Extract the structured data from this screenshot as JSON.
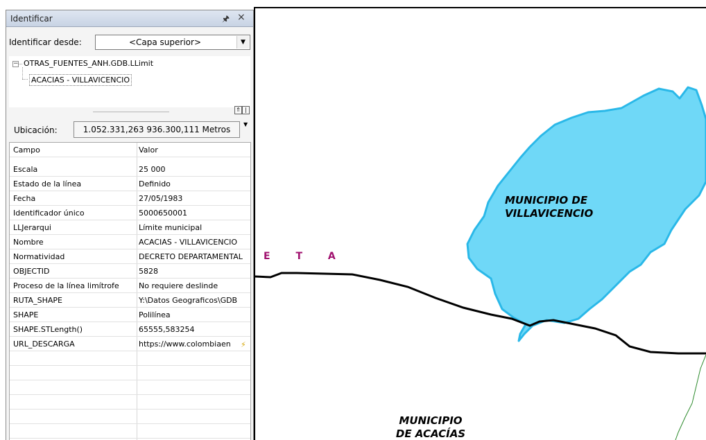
{
  "panel": {
    "title": "Identificar",
    "pin_icon": "pin-icon",
    "close_icon": "close-icon",
    "identify_from_label": "Identificar desde:",
    "identify_from_value": "<Capa superior>",
    "tree": {
      "parent": "OTRAS_FUENTES_ANH.GDB.LLimit",
      "child": "ACACIAS - VILLAVICENCIO"
    },
    "location_label": "Ubicación:",
    "location_value": "1.052.331,263  936.300,111 Metros",
    "columns": {
      "field": "Campo",
      "value": "Valor"
    },
    "rows": [
      {
        "field": "Escala",
        "value": "25 000"
      },
      {
        "field": "Estado de la línea",
        "value": "Definido"
      },
      {
        "field": "Fecha",
        "value": "27/05/1983"
      },
      {
        "field": "Identificador único",
        "value": "5000650001"
      },
      {
        "field": "LLJerarqui",
        "value": "Límite municipal"
      },
      {
        "field": "Nombre",
        "value": "ACACIAS - VILLAVICENCIO"
      },
      {
        "field": "Normatividad",
        "value": "DECRETO DEPARTAMENTAL"
      },
      {
        "field": "OBJECTID",
        "value": "5828"
      },
      {
        "field": "Proceso de la línea limítrofe",
        "value": "No requiere deslinde"
      },
      {
        "field": "RUTA_SHAPE",
        "value": "Y:\\Datos Geograficos\\GDB"
      },
      {
        "field": "SHAPE",
        "value": "Polilínea"
      },
      {
        "field": "SHAPE.STLength()",
        "value": "65555,583254"
      },
      {
        "field": "URL_DESCARGA",
        "value": "https://www.colombiaen"
      }
    ]
  },
  "map": {
    "label_villavicencio_1": "MUNICIPIO DE",
    "label_villavicencio_2": "VILLAVICENCIO",
    "label_acacias_1": "MUNICIPIO",
    "label_acacias_2": "DE ACACÍAS",
    "label_meta": "E T A",
    "colors": {
      "municipality_fill": "#6fd8f7",
      "municipality_outline": "#2ab8e8",
      "boundary_line": "#000000",
      "river": "#2e8b2e",
      "label_meta": "#a0106e"
    }
  }
}
